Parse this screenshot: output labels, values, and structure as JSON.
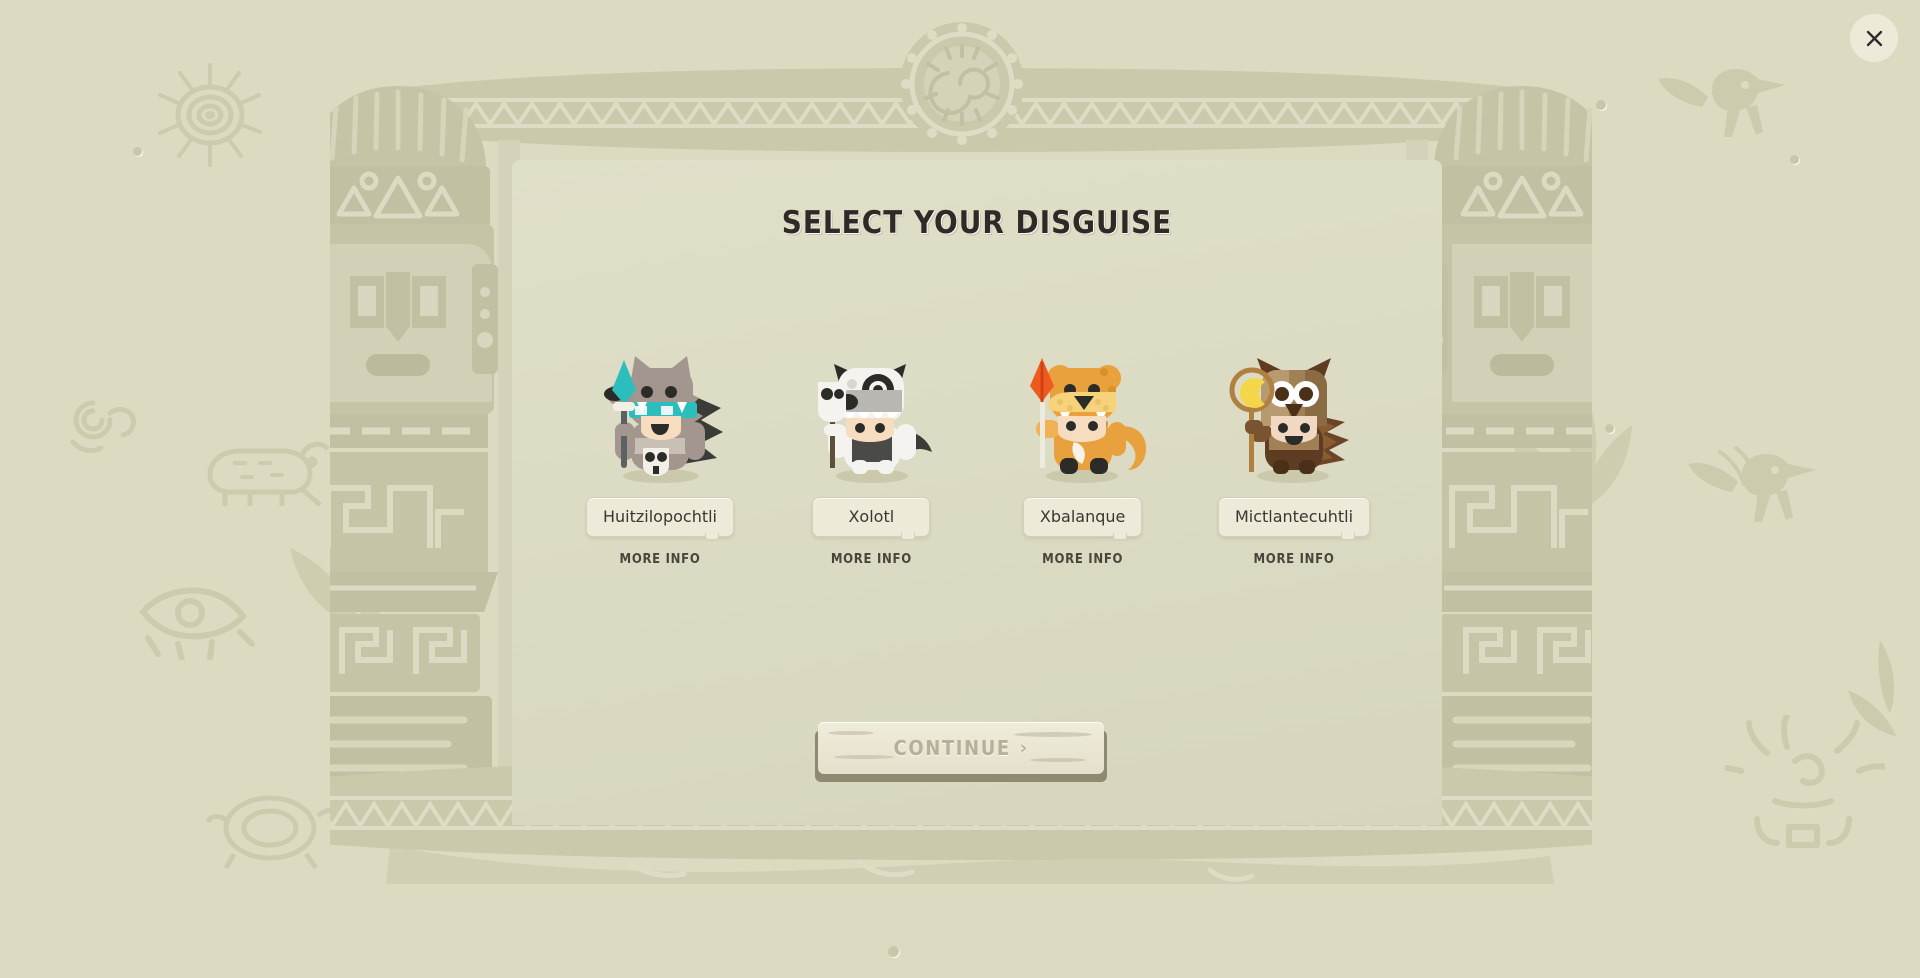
{
  "window": {
    "title": "SELECT YOUR DISGUISE"
  },
  "close": {
    "icon": "close-icon",
    "label": "Close"
  },
  "roster": [
    {
      "name": "Huitzilopochtli",
      "more_info": "MORE INFO",
      "avatar": "wolf-warrior-avatar",
      "selected": false
    },
    {
      "name": "Xolotl",
      "more_info": "MORE INFO",
      "avatar": "dog-shaman-avatar",
      "selected": false
    },
    {
      "name": "Xbalanque",
      "more_info": "MORE INFO",
      "avatar": "jaguar-avatar",
      "selected": false
    },
    {
      "name": "Mictlantecuhtli",
      "more_info": "MORE INFO",
      "avatar": "owl-avatar",
      "selected": false
    }
  ],
  "continue": {
    "label": "CONTINUE",
    "chevron": "›",
    "enabled": false
  },
  "colors": {
    "backdrop": "#dcdbc2",
    "panel": "#dfdec7",
    "stone": "#cdcbae",
    "stone_dark": "#c2c0a2",
    "nameplate": "#edeada",
    "title_text": "#2f2a26",
    "body_text": "#3a3630",
    "disabled_text": "#b4b09a"
  }
}
